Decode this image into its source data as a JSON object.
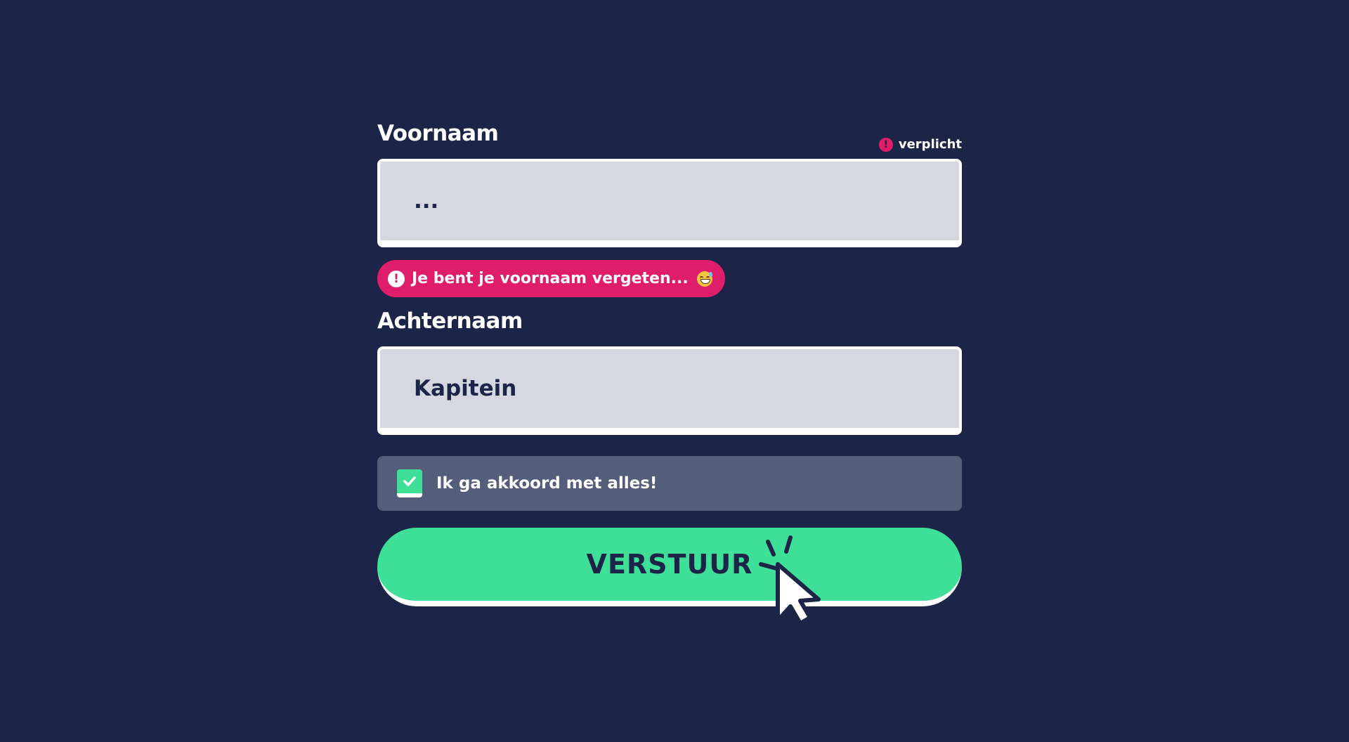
{
  "form": {
    "first_name": {
      "label": "Voornaam",
      "required_text": "verplicht",
      "placeholder": "...",
      "value": "",
      "error": "Je bent je voornaam vergeten..."
    },
    "last_name": {
      "label": "Achternaam",
      "value": "Kapitein"
    },
    "agree": {
      "label": "Ik ga akkoord met alles!",
      "checked": true
    },
    "submit_label": "VERSTUUR"
  },
  "icons": {
    "required": "exclamation-icon",
    "error": "exclamation-icon",
    "emoji": "grinning-sweat-emoji",
    "checkbox": "checkmark-icon",
    "pointer": "mouse-cursor-click-icon"
  },
  "colors": {
    "background": "#1c2447",
    "error": "#e01d6b",
    "accent": "#3ee098",
    "input_bg": "#d5d8e1",
    "checkbox_row_bg": "#545e7b"
  }
}
